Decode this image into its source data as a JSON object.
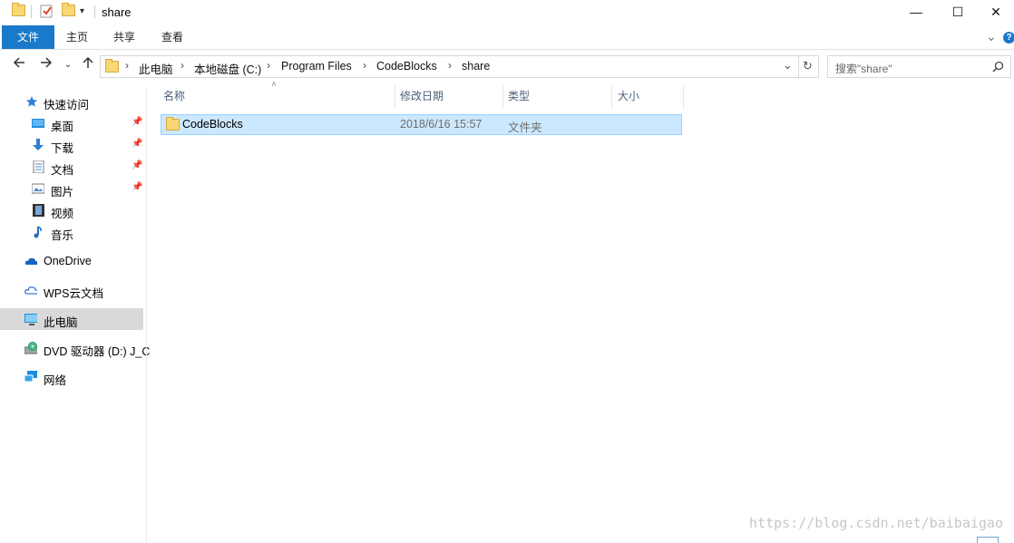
{
  "window": {
    "title": "share",
    "minimize": "—",
    "maximize": "☐",
    "close": "✕"
  },
  "ribbon": {
    "tabs": [
      "文件",
      "主页",
      "共享",
      "查看"
    ],
    "expand": "⌄",
    "help": "?"
  },
  "address": {
    "crumbs": [
      "此电脑",
      "本地磁盘 (C:)",
      "Program Files",
      "CodeBlocks",
      "share"
    ],
    "separator": "›",
    "dropdown": "⌄",
    "refresh": "↻"
  },
  "search": {
    "placeholder": "搜索\"share\"",
    "icon": "search-icon"
  },
  "nav": {
    "quick_access": "快速访问",
    "quick_items": [
      {
        "label": "桌面",
        "icon": "desktop-icon",
        "pinned": true
      },
      {
        "label": "下载",
        "icon": "download-icon",
        "pinned": true
      },
      {
        "label": "文档",
        "icon": "document-icon",
        "pinned": true
      },
      {
        "label": "图片",
        "icon": "picture-icon",
        "pinned": true
      },
      {
        "label": "视频",
        "icon": "video-icon",
        "pinned": false
      },
      {
        "label": "音乐",
        "icon": "music-icon",
        "pinned": false
      }
    ],
    "onedrive": "OneDrive",
    "wps": "WPS云文档",
    "this_pc": "此电脑",
    "dvd": "DVD 驱动器 (D:) J_C",
    "network": "网络"
  },
  "columns": {
    "name": "名称",
    "modified": "修改日期",
    "type": "类型",
    "size": "大小"
  },
  "files": [
    {
      "name": "CodeBlocks",
      "modified": "2018/6/16 15:57",
      "type": "文件夹",
      "size": ""
    }
  ],
  "watermark": "https://blog.csdn.net/baibaigao",
  "colors": {
    "accent": "#1979ca",
    "selection": "#cce8ff",
    "selection_border": "#99d1ff",
    "nav_selected": "#d9d9d9"
  }
}
